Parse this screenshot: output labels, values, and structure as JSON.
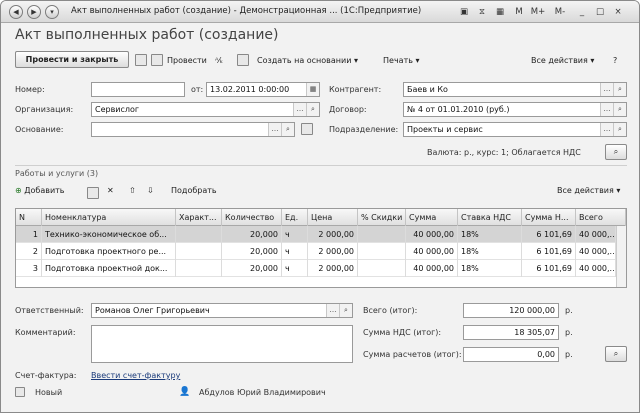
{
  "window": {
    "title": "Акт выполненных работ (создание) - Демонстрационная ... (1С:Предприятие)",
    "controls": [
      "M",
      "M+",
      "M-",
      "_",
      "□",
      "×"
    ]
  },
  "page_title": "Акт выполненных работ (создание)",
  "toolbar": {
    "post_close": "Провести и закрыть",
    "post": "Провести",
    "create_based_on": "Создать на основании",
    "print": "Печать",
    "all_actions": "Все действия"
  },
  "form": {
    "number_label": "Номер:",
    "number_value": "",
    "date_label": "от:",
    "date_value": "13.02.2011  0:00:00",
    "counterparty_label": "Контрагент:",
    "counterparty_value": "Баев и Ко",
    "organization_label": "Организация:",
    "organization_value": "Сервислог",
    "contract_label": "Договор:",
    "contract_value": "№ 4 от 01.01.2010 (руб.)",
    "basis_label": "Основание:",
    "basis_value": "",
    "division_label": "Подразделение:",
    "division_value": "Проекты и сервис",
    "currency_info": "Валюта: р., курс: 1; Облагается НДС"
  },
  "works": {
    "title": "Работы и услуги (3)",
    "add": "Добавить",
    "pick": "Подобрать",
    "all_actions": "Все действия",
    "columns": [
      "N",
      "Номенклатура",
      "Характ...",
      "Количество",
      "Ед.",
      "Цена",
      "% Скидки",
      "Сумма",
      "Ставка НДС",
      "Сумма Н...",
      "Всего"
    ],
    "rows": [
      {
        "n": "1",
        "item": "Технико-экономическое об...",
        "char": "",
        "qty": "20,000",
        "unit": "ч",
        "price": "2 000,00",
        "disc": "",
        "sum": "40 000,00",
        "vat_rate": "18%",
        "vat_sum": "6 101,69",
        "total": "40 000,..."
      },
      {
        "n": "2",
        "item": "Подготовка проектного ре...",
        "char": "",
        "qty": "20,000",
        "unit": "ч",
        "price": "2 000,00",
        "disc": "",
        "sum": "40 000,00",
        "vat_rate": "18%",
        "vat_sum": "6 101,69",
        "total": "40 000,..."
      },
      {
        "n": "3",
        "item": "Подготовка проектной док...",
        "char": "",
        "qty": "20,000",
        "unit": "ч",
        "price": "2 000,00",
        "disc": "",
        "sum": "40 000,00",
        "vat_rate": "18%",
        "vat_sum": "6 101,69",
        "total": "40 000,..."
      }
    ]
  },
  "footer": {
    "responsible_label": "Ответственный:",
    "responsible_value": "Романов Олег Григорьевич",
    "comment_label": "Комментарий:",
    "comment_value": "",
    "total_label": "Всего (итог):",
    "total_value": "120 000,00",
    "vat_label": "Сумма НДС (итог):",
    "vat_value": "18 305,07",
    "settle_label": "Сумма расчетов (итог):",
    "settle_value": "0,00",
    "currency": "р.",
    "invoice_label": "Счет-фактура:",
    "invoice_link": "Ввести счет-фактуру",
    "status": "Новый",
    "author": "Абдулов Юрий Владимирович"
  }
}
